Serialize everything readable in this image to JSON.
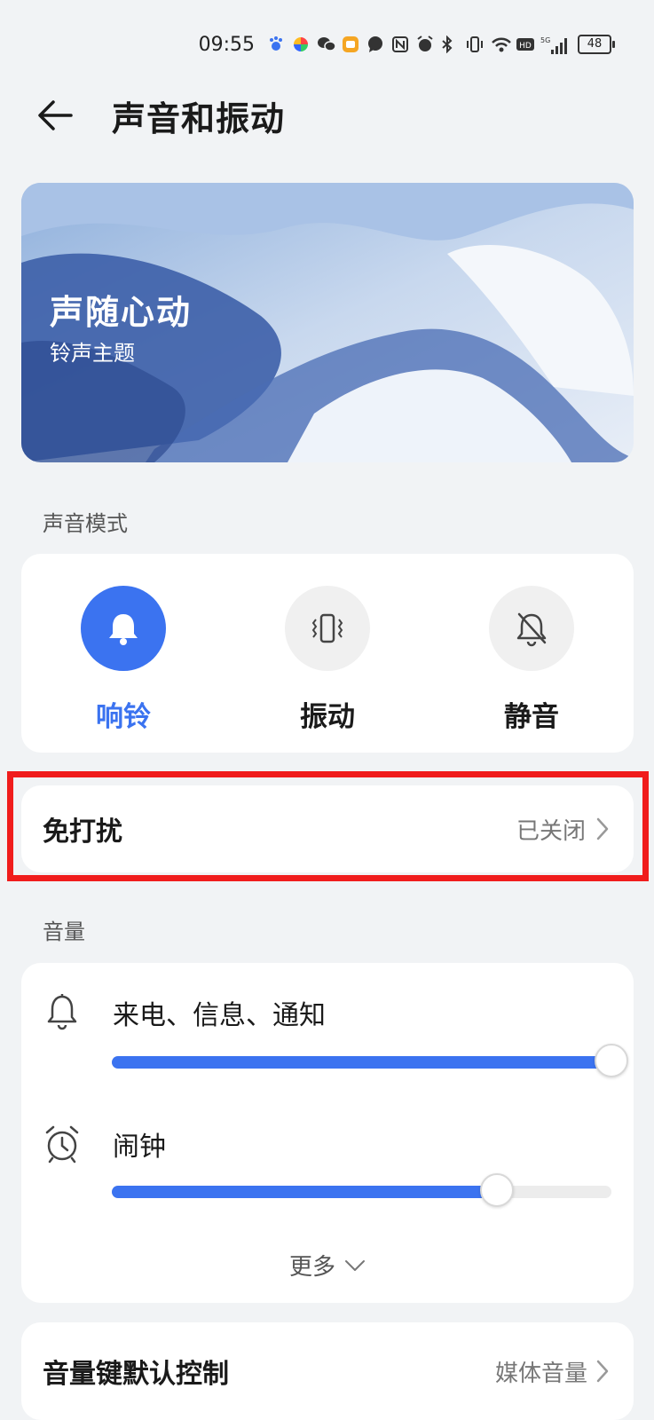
{
  "status_bar": {
    "time": "09:55",
    "battery": "48",
    "icons": [
      "baidu-icon",
      "colorful-app-icon",
      "wechat-icon",
      "notes-app-icon",
      "message-icon",
      "nfc-icon",
      "alarm-icon",
      "bluetooth-icon",
      "vibrate-icon",
      "wifi-icon",
      "hd-icon",
      "signal-5g-icon"
    ]
  },
  "header": {
    "title": "声音和振动"
  },
  "banner": {
    "title": "声随心动",
    "subtitle": "铃声主题"
  },
  "sound_mode": {
    "section_label": "声音模式",
    "modes": [
      {
        "label": "响铃",
        "icon": "bell-icon",
        "active": true
      },
      {
        "label": "振动",
        "icon": "vibrate-icon",
        "active": false
      },
      {
        "label": "静音",
        "icon": "bell-off-icon",
        "active": false
      }
    ],
    "accent_color": "#3b73f0"
  },
  "dnd": {
    "label": "免打扰",
    "value": "已关闭"
  },
  "volume": {
    "section_label": "音量",
    "rows": [
      {
        "label": "来电、信息、通知",
        "icon": "bell-icon",
        "level": 1.0
      },
      {
        "label": "闹钟",
        "icon": "alarm-clock-icon",
        "level": 0.77
      }
    ],
    "more_label": "更多"
  },
  "volume_key": {
    "label": "音量键默认控制",
    "value": "媒体音量"
  }
}
